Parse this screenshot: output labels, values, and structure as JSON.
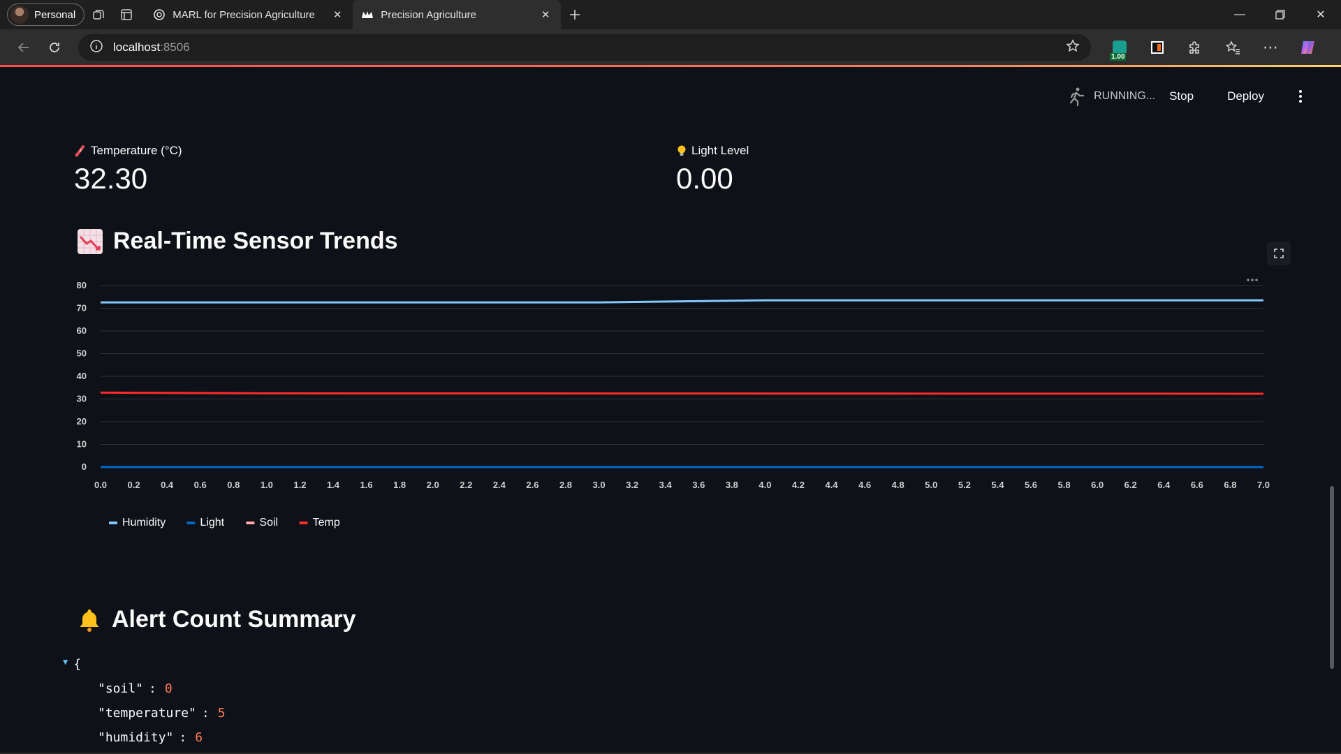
{
  "browser": {
    "profile_label": "Personal",
    "tabs": [
      {
        "title": "MARL for Precision Agriculture",
        "active": false
      },
      {
        "title": "Precision Agriculture",
        "active": true
      }
    ],
    "url_host": "localhost",
    "url_port": ":8506",
    "extension_badge": "1.00"
  },
  "app": {
    "status_text": "RUNNING...",
    "stop_label": "Stop",
    "deploy_label": "Deploy",
    "metrics": [
      {
        "label": "Temperature (°C)",
        "value": "32.30",
        "icon": "thermometer-icon"
      },
      {
        "label": "Light Level",
        "value": "0.00",
        "icon": "lightbulb-icon"
      }
    ],
    "trends_title": "Real-Time Sensor Trends",
    "alerts_title": "Alert Count Summary",
    "alerts_json": [
      {
        "key": "\"soil\"",
        "value": "0"
      },
      {
        "key": "\"temperature\"",
        "value": "5"
      },
      {
        "key": "\"humidity\"",
        "value": "6"
      }
    ],
    "json_open": "{"
  },
  "colors": {
    "humidity": "#83c9ff",
    "light": "#0068c9",
    "soil": "#ffabab",
    "temp": "#ff2b2b",
    "accent": "#ff4b4b"
  },
  "chart_data": {
    "type": "line",
    "x": [
      0,
      0.2,
      0.4,
      0.6,
      0.8,
      1.0,
      1.2,
      1.4,
      1.6,
      1.8,
      2.0,
      2.2,
      2.4,
      2.6,
      2.8,
      3.0,
      3.2,
      3.4,
      3.6,
      3.8,
      4.0,
      4.2,
      4.4,
      4.6,
      4.8,
      5.0,
      5.2,
      5.4,
      5.6,
      5.8,
      6.0,
      6.2,
      6.4,
      6.6,
      6.8,
      7.0
    ],
    "x_ticks": [
      "0.0",
      "0.2",
      "0.4",
      "0.6",
      "0.8",
      "1.0",
      "1.2",
      "1.4",
      "1.6",
      "1.8",
      "2.0",
      "2.2",
      "2.4",
      "2.6",
      "2.8",
      "3.0",
      "3.2",
      "3.4",
      "3.6",
      "3.8",
      "4.0",
      "4.2",
      "4.4",
      "4.6",
      "4.8",
      "5.0",
      "5.2",
      "5.4",
      "5.6",
      "5.8",
      "6.0",
      "6.2",
      "6.4",
      "6.6",
      "6.8",
      "7.0"
    ],
    "y_ticks": [
      "0",
      "10",
      "20",
      "30",
      "40",
      "50",
      "60",
      "70",
      "80"
    ],
    "ylim": [
      0,
      80
    ],
    "xlim": [
      0,
      7
    ],
    "grid": true,
    "legend_position": "bottom-left",
    "series": [
      {
        "name": "Humidity",
        "points": [
          [
            0,
            72.6
          ],
          [
            3,
            72.6
          ],
          [
            4,
            73.5
          ],
          [
            7,
            73.5
          ]
        ]
      },
      {
        "name": "Light",
        "points": [
          [
            0,
            0
          ],
          [
            7,
            0
          ]
        ]
      },
      {
        "name": "Soil",
        "points": [
          [
            0,
            0
          ],
          [
            7,
            0
          ]
        ]
      },
      {
        "name": "Temp",
        "points": [
          [
            0,
            32.8
          ],
          [
            1,
            32.5
          ],
          [
            7,
            32.3
          ]
        ]
      }
    ]
  }
}
